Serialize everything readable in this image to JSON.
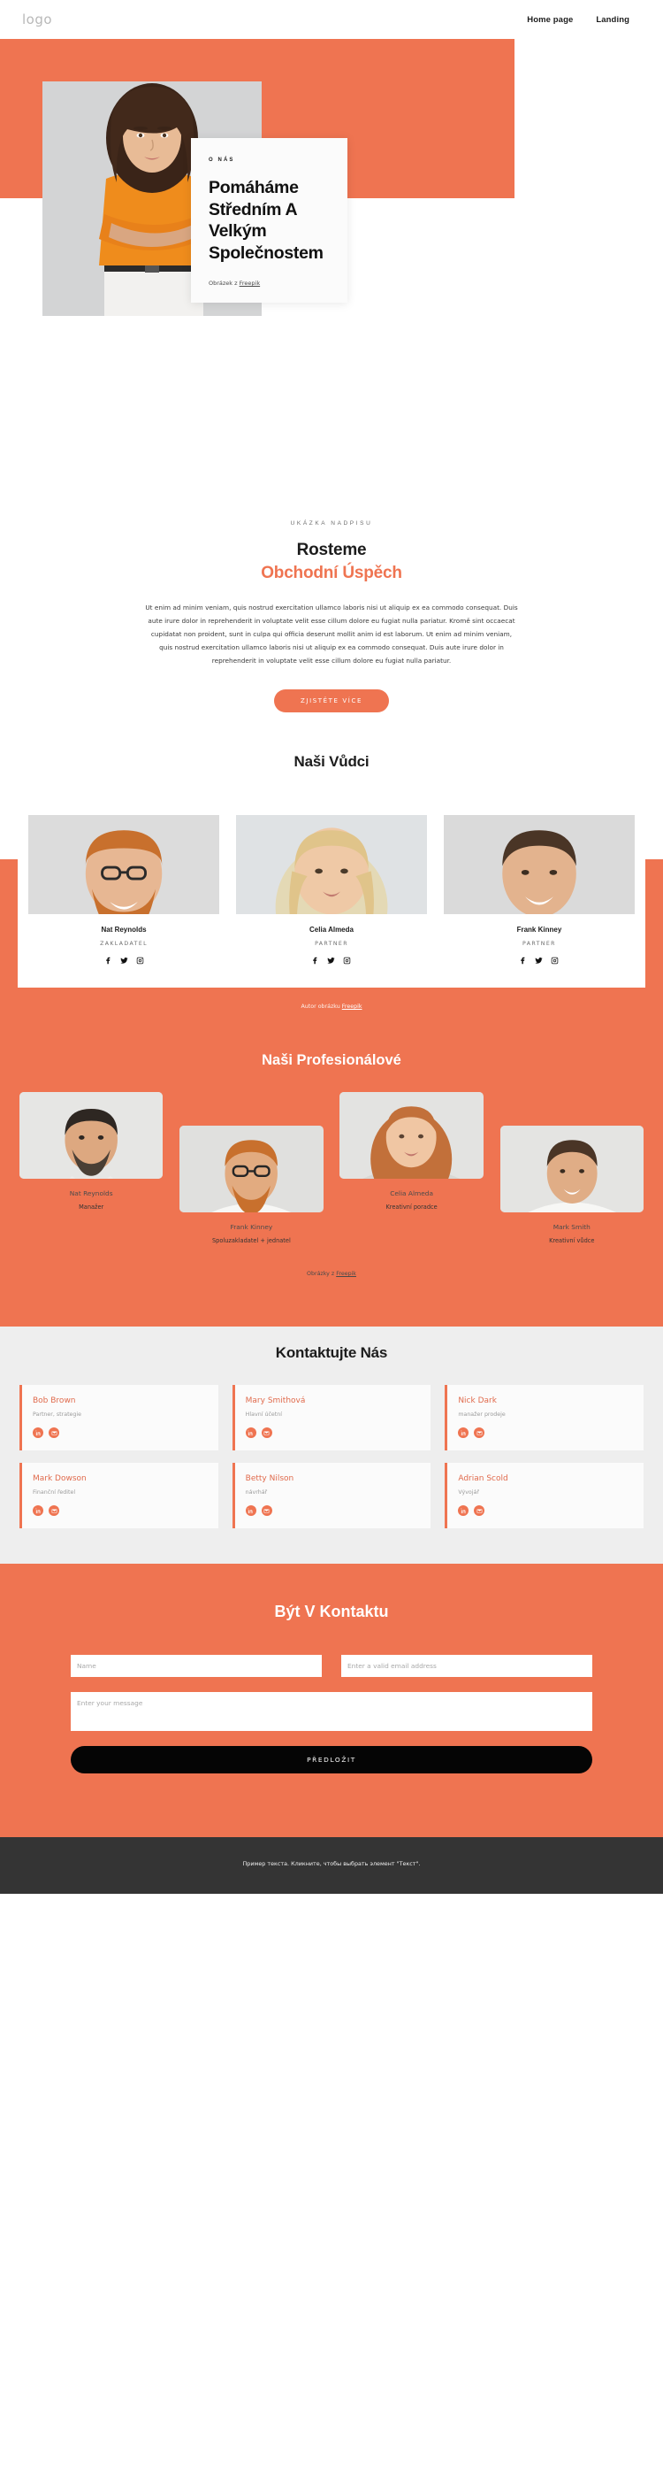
{
  "header": {
    "logo": "logo",
    "nav": [
      {
        "label": "Home page"
      },
      {
        "label": "Landing"
      }
    ]
  },
  "hero": {
    "eyebrow": "O NÁS",
    "title": "Pomáháme Středním A Velkým Společnostem",
    "credit_prefix": "Obrázek z ",
    "credit_link": "Freepik"
  },
  "grow": {
    "kicker": "UKÁZKA NADPISU",
    "title_line1": "Rosteme",
    "title_line2": "Obchodní Úspěch",
    "paragraph": "Ut enim ad minim veniam, quis nostrud exercitation ullamco laboris nisi ut aliquip ex ea commodo consequat. Duis aute irure dolor in reprehenderit in voluptate velit esse cillum dolore eu fugiat nulla pariatur. Kromě sint occaecat cupidatat non proident, sunt in culpa qui officia deserunt mollit anim id est laborum. Ut enim ad minim veniam, quis nostrud exercitation ullamco laboris nisi ut aliquip ex ea commodo consequat. Duis aute irure dolor in reprehenderit in voluptate velit esse cillum dolore eu fugiat nulla pariatur.",
    "button": "ZJISTĚTE VÍCE"
  },
  "leaders": {
    "title": "Naši Vůdci",
    "people": [
      {
        "name": "Nat Reynolds",
        "role": "ZAKLADATEL"
      },
      {
        "name": "Celia Almeda",
        "role": "PARTNER"
      },
      {
        "name": "Frank Kinney",
        "role": "PARTNER"
      }
    ],
    "credit_prefix": "Autor obrázku ",
    "credit_link": "Freepik"
  },
  "pros": {
    "title": "Naši Profesionálové",
    "people": [
      {
        "name": "Nat Reynolds",
        "role": "Manažer"
      },
      {
        "name": "Frank Kinney",
        "role": "Spoluzakladatel + jednatel"
      },
      {
        "name": "Celia Almeda",
        "role": "Kreativní poradce"
      },
      {
        "name": "Mark Smith",
        "role": "Kreativní vůdce"
      }
    ],
    "credit_prefix": "Obrázky z ",
    "credit_link": "Freepik"
  },
  "contacts": {
    "title": "Kontaktujte Nás",
    "cards": [
      {
        "name": "Bob Brown",
        "role": "Partner, strategie"
      },
      {
        "name": "Mary Smithová",
        "role": "Hlavní účetní"
      },
      {
        "name": "Nick Dark",
        "role": "manažer prodeje"
      },
      {
        "name": "Mark Dowson",
        "role": "Finanční ředitel"
      },
      {
        "name": "Betty Nilson",
        "role": "návrhář"
      },
      {
        "name": "Adrian Scold",
        "role": "Vývojář"
      }
    ]
  },
  "form": {
    "title": "Být V Kontaktu",
    "name_placeholder": "Name",
    "email_placeholder": "Enter a valid email address",
    "message_placeholder": "Enter your message",
    "submit": "PŘEDLOŽIT"
  },
  "footer": {
    "text": "Пример текста. Кликните, чтобы выбрать элемент \"Текст\"."
  },
  "colors": {
    "accent": "#ef7451",
    "dark": "#343434",
    "light_gray": "#eeeeee"
  }
}
